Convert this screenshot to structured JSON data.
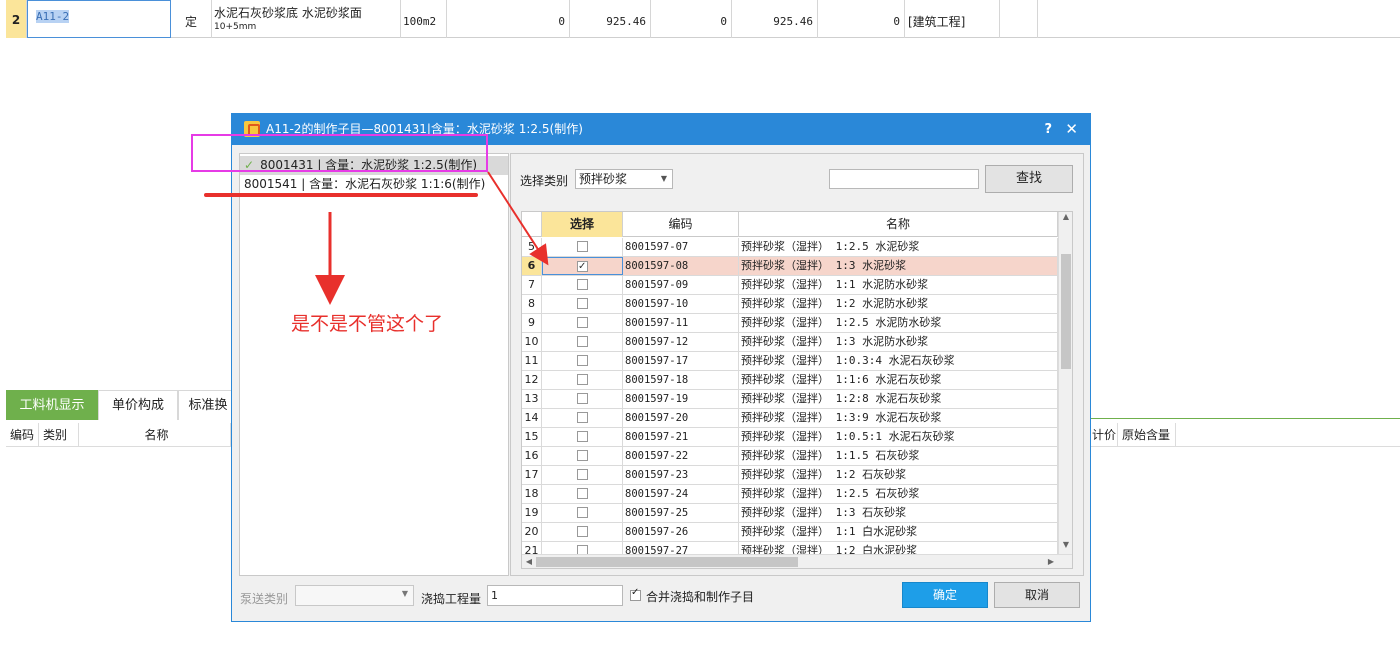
{
  "background_table": {
    "row": {
      "rownum": "2",
      "code": "A11-2",
      "type": "定",
      "name": "水泥石灰砂浆底 水泥砂浆面",
      "name_sub": "10+5mm",
      "unit": "100m2",
      "v1": "0",
      "v2": "925.46",
      "v3": "0",
      "v4": "925.46",
      "v5": "0",
      "category": "[建筑工程]"
    }
  },
  "lower_panel": {
    "tabs": [
      "工料机显示",
      "单价构成",
      "标准换"
    ],
    "headers": [
      "编码",
      "类别",
      "名称"
    ],
    "right_headers": [
      "计价",
      "原始含量"
    ]
  },
  "dialog": {
    "title": "A11-2的制作子目—8001431|含量：水泥砂浆 1:2.5(制作)",
    "help": "?",
    "close": "✕",
    "left_items": [
      {
        "check": "✓",
        "label": "8001431 | 含量：水泥砂浆 1:2.5(制作)"
      },
      {
        "check": "",
        "label": "8001541 | 含量：水泥石灰砂浆 1:1:6(制作)"
      }
    ],
    "category_label": "选择类别",
    "category_value": "预拌砂浆",
    "search_value": "",
    "search_button": "查找",
    "grid": {
      "headers": [
        "选择",
        "编码",
        "名称"
      ],
      "rows": [
        {
          "n": "5",
          "checked": false,
          "code": "8001597-07",
          "name": "预拌砂浆（湿拌） 1:2.5 水泥砂浆"
        },
        {
          "n": "6",
          "checked": true,
          "code": "8001597-08",
          "name": "预拌砂浆（湿拌） 1:3 水泥砂浆"
        },
        {
          "n": "7",
          "checked": false,
          "code": "8001597-09",
          "name": "预拌砂浆（湿拌） 1:1 水泥防水砂浆"
        },
        {
          "n": "8",
          "checked": false,
          "code": "8001597-10",
          "name": "预拌砂浆（湿拌） 1:2 水泥防水砂浆"
        },
        {
          "n": "9",
          "checked": false,
          "code": "8001597-11",
          "name": "预拌砂浆（湿拌） 1:2.5 水泥防水砂浆"
        },
        {
          "n": "10",
          "checked": false,
          "code": "8001597-12",
          "name": "预拌砂浆（湿拌） 1:3 水泥防水砂浆"
        },
        {
          "n": "11",
          "checked": false,
          "code": "8001597-17",
          "name": "预拌砂浆（湿拌） 1:0.3:4 水泥石灰砂浆"
        },
        {
          "n": "12",
          "checked": false,
          "code": "8001597-18",
          "name": "预拌砂浆（湿拌） 1:1:6 水泥石灰砂浆"
        },
        {
          "n": "13",
          "checked": false,
          "code": "8001597-19",
          "name": "预拌砂浆（湿拌） 1:2:8 水泥石灰砂浆"
        },
        {
          "n": "14",
          "checked": false,
          "code": "8001597-20",
          "name": "预拌砂浆（湿拌） 1:3:9 水泥石灰砂浆"
        },
        {
          "n": "15",
          "checked": false,
          "code": "8001597-21",
          "name": "预拌砂浆（湿拌） 1:0.5:1 水泥石灰砂浆"
        },
        {
          "n": "16",
          "checked": false,
          "code": "8001597-22",
          "name": "预拌砂浆（湿拌） 1:1.5 石灰砂浆"
        },
        {
          "n": "17",
          "checked": false,
          "code": "8001597-23",
          "name": "预拌砂浆（湿拌） 1:2 石灰砂浆"
        },
        {
          "n": "18",
          "checked": false,
          "code": "8001597-24",
          "name": "预拌砂浆（湿拌） 1:2.5 石灰砂浆"
        },
        {
          "n": "19",
          "checked": false,
          "code": "8001597-25",
          "name": "预拌砂浆（湿拌） 1:3 石灰砂浆"
        },
        {
          "n": "20",
          "checked": false,
          "code": "8001597-26",
          "name": "预拌砂浆（湿拌） 1:1 白水泥砂浆"
        },
        {
          "n": "21",
          "checked": false,
          "code": "8001597-27",
          "name": "预拌砂浆（湿拌） 1:2 白水泥砂浆"
        }
      ]
    },
    "pump_label": "泵送类别",
    "pump_value": "",
    "pour_label": "浇捣工程量",
    "pour_value": "1",
    "merge_label": "合并浇捣和制作子目",
    "ok_button": "确定",
    "cancel_button": "取消"
  },
  "annotation": {
    "text": "是不是不管这个了",
    "color": "#e8302c",
    "box_color": "#e63be6"
  }
}
